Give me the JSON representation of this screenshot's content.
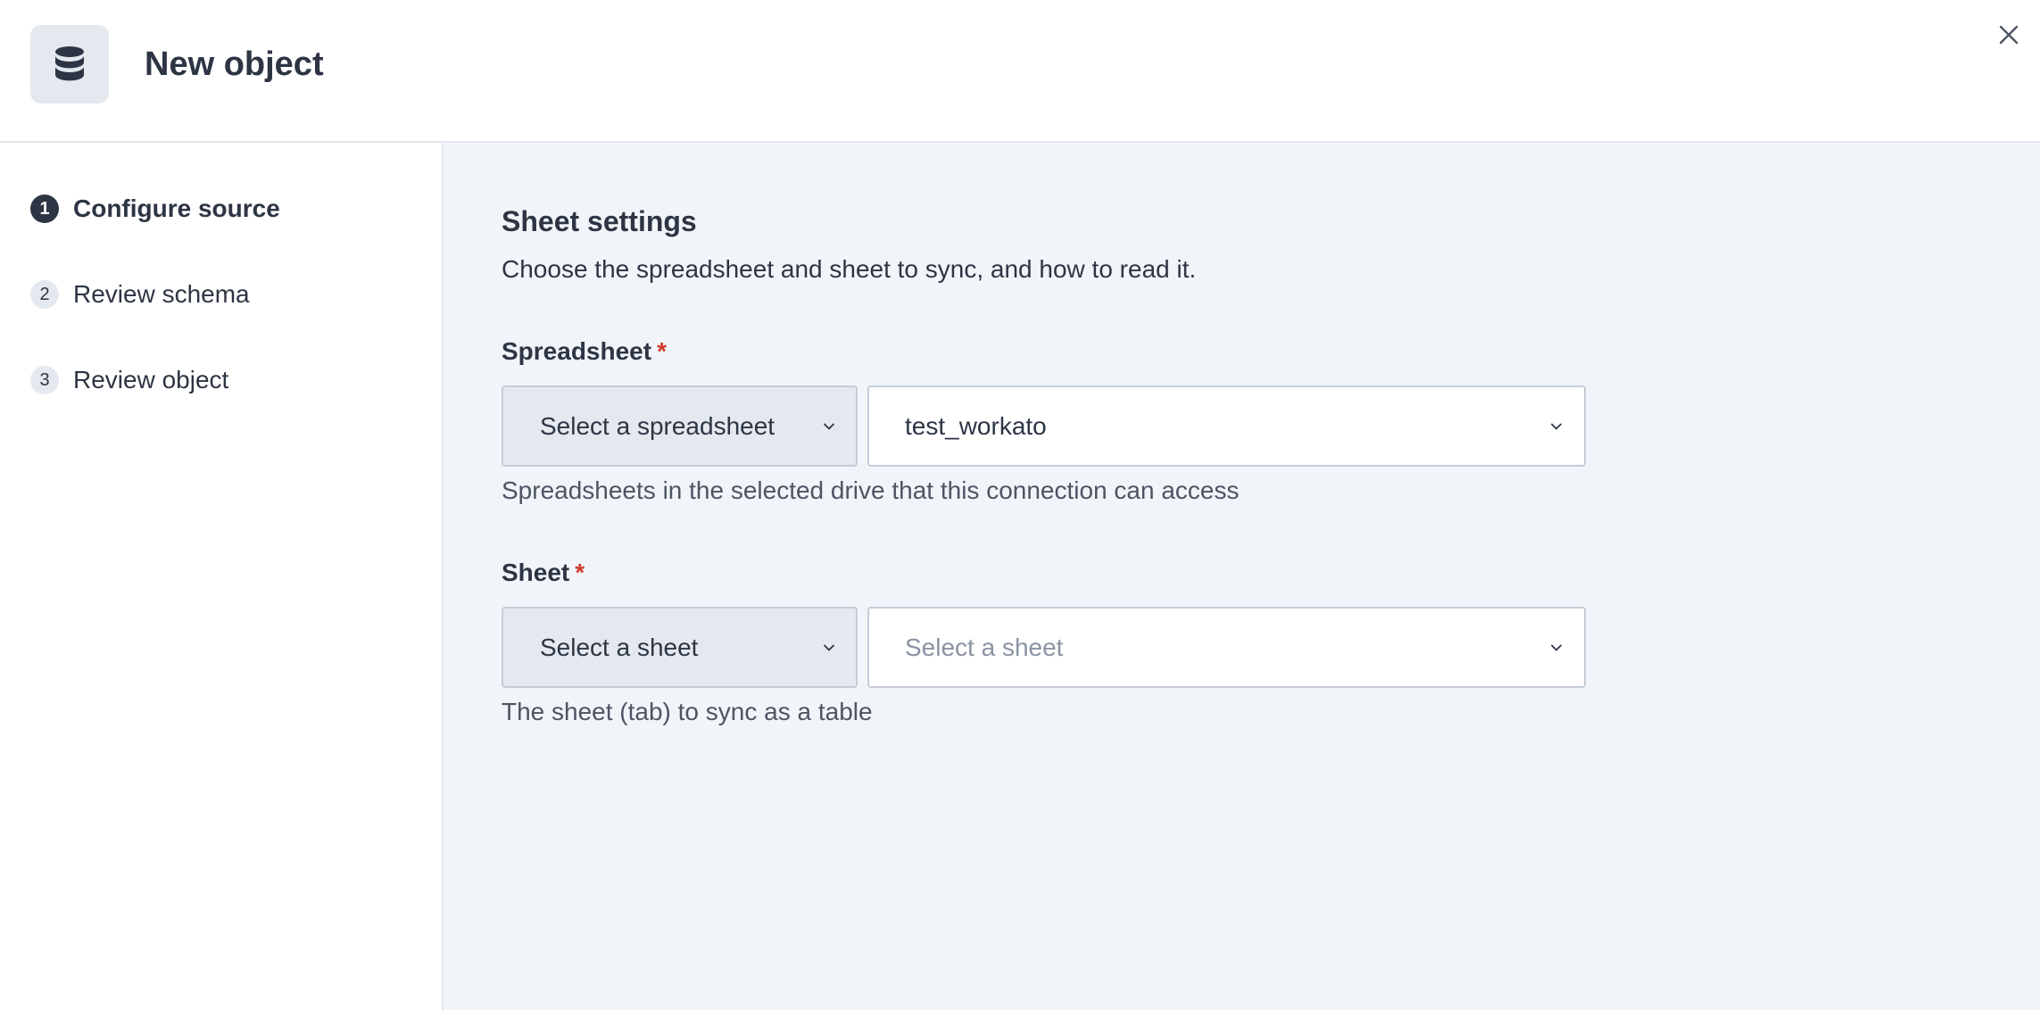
{
  "header": {
    "title": "New object",
    "icon": "database-icon",
    "close_icon": "close-icon"
  },
  "steps": [
    {
      "number": "1",
      "label": "Configure source",
      "active": true
    },
    {
      "number": "2",
      "label": "Review schema",
      "active": false
    },
    {
      "number": "3",
      "label": "Review object",
      "active": false
    }
  ],
  "main": {
    "title": "Sheet settings",
    "description": "Choose the spreadsheet and sheet to sync, and how to read it.",
    "spreadsheet": {
      "label": "Spreadsheet",
      "required_mark": "*",
      "mode_select": "Select a spreadsheet",
      "value": "test_workato",
      "help": "Spreadsheets in the selected drive that this connection can access"
    },
    "sheet": {
      "label": "Sheet",
      "required_mark": "*",
      "mode_select": "Select a sheet",
      "placeholder": "Select a sheet",
      "help": "The sheet (tab) to sync as a table"
    }
  },
  "colors": {
    "text": "#2d3544",
    "muted": "#8a93a3",
    "required": "#d13a2a",
    "panel": "#f1f4f9",
    "select_mode_bg": "#e4e8ef"
  }
}
